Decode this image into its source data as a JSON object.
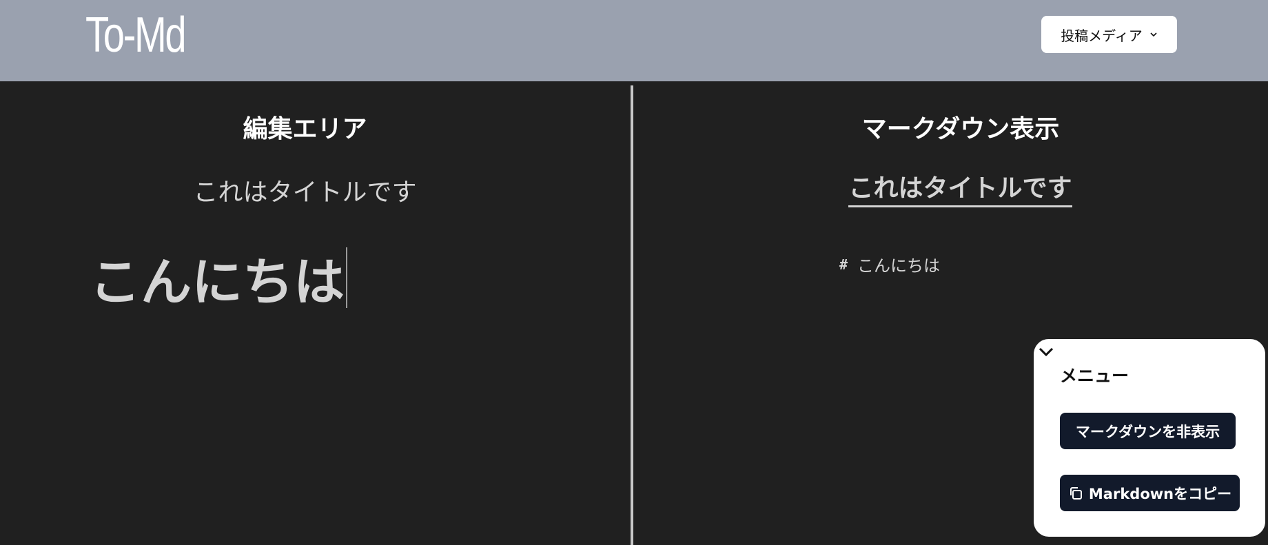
{
  "header": {
    "logo": "To-Md",
    "media_button_label": "投稿メディア"
  },
  "editor": {
    "heading": "編集エリア",
    "title_value": "これはタイトルです",
    "body_h1": "こんにちは"
  },
  "preview": {
    "heading": "マークダウン表示",
    "title": "これはタイトルです",
    "line_marker": "#",
    "line_text": "こんにちは"
  },
  "menu": {
    "title": "メニュー",
    "hide_markdown_label": "マークダウンを非表示",
    "copy_markdown_label": "Markdownをコピー"
  },
  "icons": {
    "media_dropdown": "chevron-down-icon",
    "menu_collapse": "chevron-down-icon",
    "copy": "copy-icon"
  },
  "colors": {
    "header_bg": "#9aa1af",
    "page_bg": "#202020",
    "button_dark": "#121a2b"
  }
}
